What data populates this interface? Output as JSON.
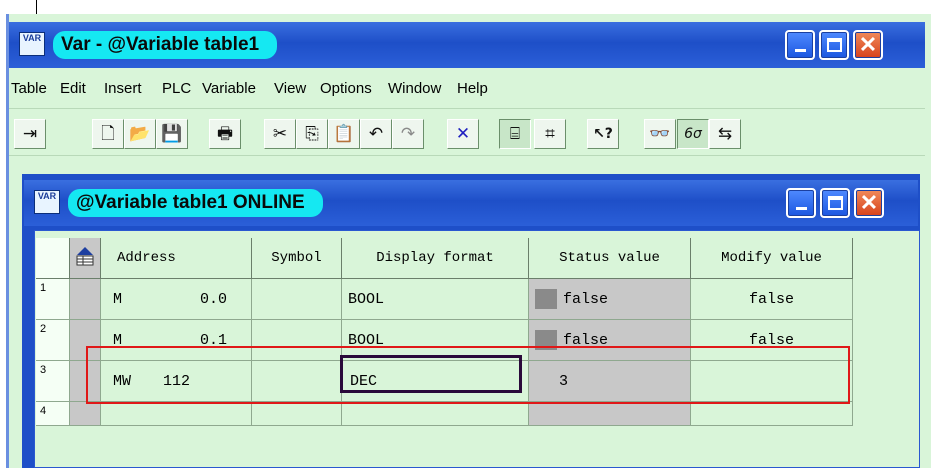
{
  "outer": {
    "title": "Var - @Variable table1",
    "icon_text": "VAR",
    "buttons": {
      "minimize_icon": "minimize-icon",
      "maximize_icon": "maximize-icon",
      "close_icon": "close-icon",
      "close_glyph": "✕"
    }
  },
  "menu": {
    "items": [
      "Table",
      "Edit",
      "Insert",
      "PLC",
      "Variable",
      "View",
      "Options",
      "Window",
      "Help"
    ]
  },
  "toolbar": {
    "icons": [
      {
        "name": "pin-icon",
        "glyph": "⇥"
      },
      {
        "name": "new-icon",
        "glyph": "🗋"
      },
      {
        "name": "open-icon",
        "glyph": "📂"
      },
      {
        "name": "save-icon",
        "glyph": "💾"
      },
      {
        "name": "print-icon",
        "glyph": "🖶"
      },
      {
        "name": "cut-icon",
        "glyph": "✂"
      },
      {
        "name": "copy-icon",
        "glyph": "⎘"
      },
      {
        "name": "paste-icon",
        "glyph": "📋"
      },
      {
        "name": "undo-icon",
        "glyph": "↶"
      },
      {
        "name": "redo-icon",
        "glyph": "↷"
      },
      {
        "name": "delete-icon",
        "glyph": "✕"
      },
      {
        "name": "online-icon",
        "glyph": "⌸"
      },
      {
        "name": "plc-status-icon",
        "glyph": "⌗"
      },
      {
        "name": "help-icon",
        "glyph": "↖?"
      },
      {
        "name": "monitor-icon",
        "glyph": "👓"
      },
      {
        "name": "modify-icon",
        "glyph": "6σ"
      },
      {
        "name": "trigger-icon",
        "glyph": "⇆"
      }
    ]
  },
  "inner": {
    "title": "@Variable table1  ONLINE",
    "icon_text": "VAR",
    "buttons": {
      "close_glyph": "✕"
    }
  },
  "table": {
    "headers": {
      "address": "Address",
      "symbol": "Symbol",
      "display_format": "Display format",
      "status_value": "Status value",
      "modify_value": "Modify value"
    },
    "header_icon": "table-grid-icon",
    "rows": [
      {
        "num": "1",
        "addr_type": "M",
        "addr_num": "0.0",
        "symbol": "",
        "format": "BOOL",
        "status": "false",
        "modify": "false"
      },
      {
        "num": "2",
        "addr_type": "M",
        "addr_num": "0.1",
        "symbol": "",
        "format": "BOOL",
        "status": "false",
        "modify": "false"
      },
      {
        "num": "3",
        "addr_type": "MW",
        "addr_num": "112",
        "symbol": "",
        "format": "DEC",
        "status": "3",
        "modify": ""
      },
      {
        "num": "4",
        "addr_type": "",
        "addr_num": "",
        "symbol": "",
        "format": "",
        "status": "",
        "modify": ""
      }
    ]
  },
  "colors": {
    "titlebar": "#1e4fc8",
    "title_pill": "#15e8f2",
    "window_bg": "#d9f5d9",
    "highlight": "#e01818"
  }
}
